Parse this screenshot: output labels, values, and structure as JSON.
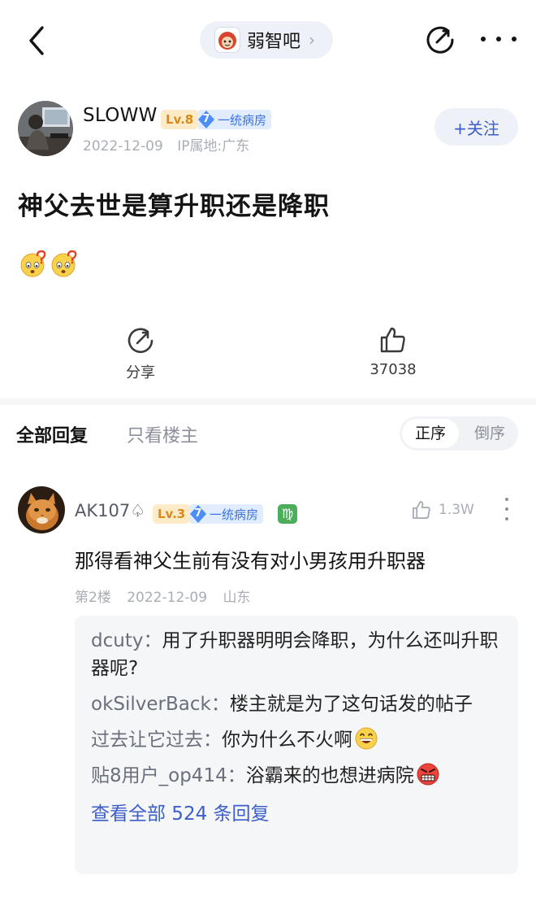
{
  "header": {
    "forum_name": "弱智吧",
    "forum_chevron": "›"
  },
  "post": {
    "author": {
      "name": "SLOWW",
      "level": "Lv.8",
      "rank_number": "7",
      "rank_title": "一统病房",
      "date": "2022-12-09",
      "ip_location": "IP属地:广东"
    },
    "follow_label": "+关注",
    "title": "神父去世是算升职还是降职",
    "emojis": [
      "confused-face-emoji",
      "confused-face-emoji"
    ],
    "share_label": "分享",
    "like_count": "37038"
  },
  "reply_tabs": {
    "all": "全部回复",
    "op_only": "只看楼主",
    "order_asc": "正序",
    "order_desc": "倒序"
  },
  "comment": {
    "author": {
      "name": "AK107♤",
      "level": "Lv.3",
      "rank_number": "7",
      "rank_title": "一统病房",
      "zodiac": "♍"
    },
    "like_count": "1.3W",
    "text": "那得看神父生前有没有对小男孩用升职器",
    "floor": "第2楼",
    "date": "2022-12-09",
    "location": "山东",
    "sub_replies": [
      {
        "user": "dcuty",
        "separator": "：",
        "text": "用了升职器明明会降职，为什么还叫升职器呢?"
      },
      {
        "user": "okSilverBack",
        "separator": "：",
        "text": "楼主就是为了这句话发的帖子"
      },
      {
        "user": "过去让它过去",
        "separator": "：",
        "text": "你为什么不火啊",
        "emoji": "grin-emoji"
      },
      {
        "user": "贴8用户_op414",
        "separator": "：",
        "text": "浴霸来的也想进病院",
        "emoji": "angry-grin-emoji"
      }
    ],
    "view_all": "查看全部 524 条回复"
  },
  "colors": {
    "accent_blue": "#3b5ec9",
    "level_bg": "#fdebc7",
    "level_text": "#d98a1a",
    "rank_blue": "#3a73e6",
    "muted": "#a9adb6"
  }
}
